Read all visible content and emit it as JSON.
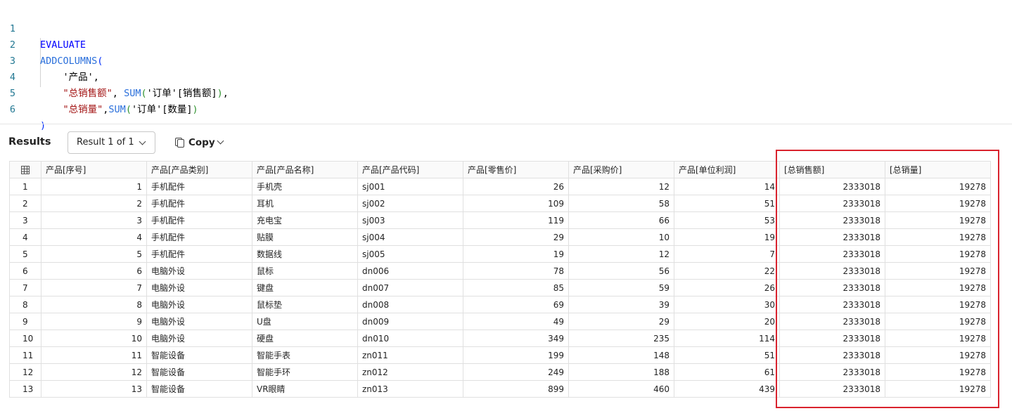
{
  "editor": {
    "line_numbers": [
      "1",
      "2",
      "3",
      "4",
      "5",
      "6"
    ],
    "tokens": {
      "evaluate": "EVALUATE",
      "addcolumns": "ADDCOLUMNS",
      "open_paren": "(",
      "close_paren": ")",
      "table_arg": "'产品'",
      "comma": ",",
      "col1_name": "\"总销售额\"",
      "sum": "SUM",
      "col1_ref_table": "'订单'",
      "col1_ref_col": "[销售额]",
      "col2_name": "\"总销量\"",
      "col2_ref_table": "'订单'",
      "col2_ref_col": "[数量]"
    }
  },
  "results": {
    "title": "Results",
    "result_selector": "Result 1 of 1",
    "copy_label": "Copy"
  },
  "table": {
    "columns": [
      "产品[序号]",
      "产品[产品类别]",
      "产品[产品名称]",
      "产品[产品代码]",
      "产品[零售价]",
      "产品[采购价]",
      "产品[单位利润]",
      "[总销售额]",
      "[总销量]"
    ],
    "rows": [
      {
        "row": "1",
        "c": [
          "1",
          "手机配件",
          "手机壳",
          "sj001",
          "26",
          "12",
          "14",
          "2333018",
          "19278"
        ]
      },
      {
        "row": "2",
        "c": [
          "2",
          "手机配件",
          "耳机",
          "sj002",
          "109",
          "58",
          "51",
          "2333018",
          "19278"
        ]
      },
      {
        "row": "3",
        "c": [
          "3",
          "手机配件",
          "充电宝",
          "sj003",
          "119",
          "66",
          "53",
          "2333018",
          "19278"
        ]
      },
      {
        "row": "4",
        "c": [
          "4",
          "手机配件",
          "贴膜",
          "sj004",
          "29",
          "10",
          "19",
          "2333018",
          "19278"
        ]
      },
      {
        "row": "5",
        "c": [
          "5",
          "手机配件",
          "数据线",
          "sj005",
          "19",
          "12",
          "7",
          "2333018",
          "19278"
        ]
      },
      {
        "row": "6",
        "c": [
          "6",
          "电脑外设",
          "鼠标",
          "dn006",
          "78",
          "56",
          "22",
          "2333018",
          "19278"
        ]
      },
      {
        "row": "7",
        "c": [
          "7",
          "电脑外设",
          "键盘",
          "dn007",
          "85",
          "59",
          "26",
          "2333018",
          "19278"
        ]
      },
      {
        "row": "8",
        "c": [
          "8",
          "电脑外设",
          "鼠标垫",
          "dn008",
          "69",
          "39",
          "30",
          "2333018",
          "19278"
        ]
      },
      {
        "row": "9",
        "c": [
          "9",
          "电脑外设",
          "U盘",
          "dn009",
          "49",
          "29",
          "20",
          "2333018",
          "19278"
        ]
      },
      {
        "row": "10",
        "c": [
          "10",
          "电脑外设",
          "硬盘",
          "dn010",
          "349",
          "235",
          "114",
          "2333018",
          "19278"
        ]
      },
      {
        "row": "11",
        "c": [
          "11",
          "智能设备",
          "智能手表",
          "zn011",
          "199",
          "148",
          "51",
          "2333018",
          "19278"
        ]
      },
      {
        "row": "12",
        "c": [
          "12",
          "智能设备",
          "智能手环",
          "zn012",
          "249",
          "188",
          "61",
          "2333018",
          "19278"
        ]
      },
      {
        "row": "13",
        "c": [
          "13",
          "智能设备",
          "VR眼睛",
          "zn013",
          "899",
          "460",
          "439",
          "2333018",
          "19278"
        ]
      }
    ]
  },
  "colors": {
    "highlight_border": "#d9232e",
    "keyword": "#0000ff",
    "string": "#a31515"
  }
}
